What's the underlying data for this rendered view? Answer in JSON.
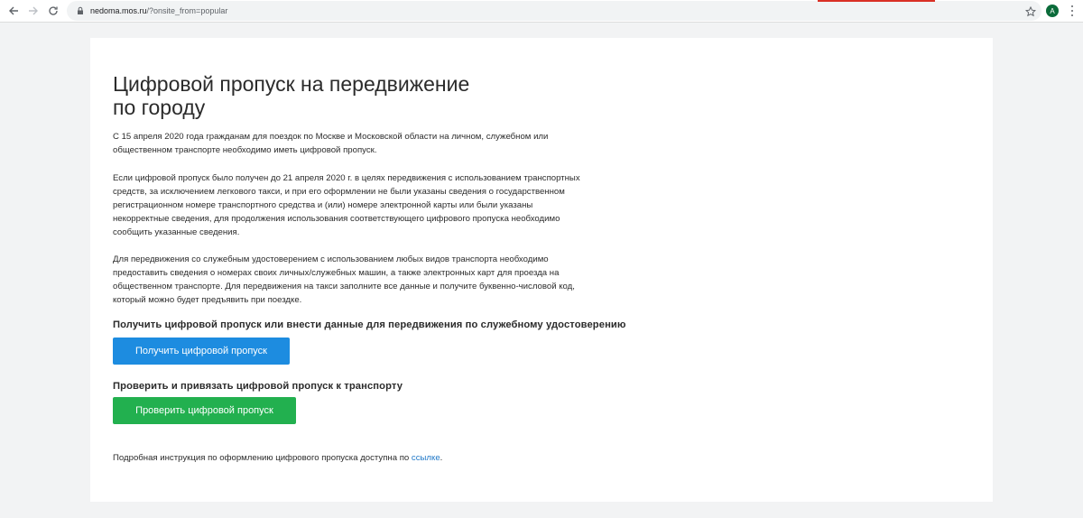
{
  "browser": {
    "url_host": "nedoma.mos.ru",
    "url_path": "/?onsite_from=popular",
    "avatar_letter": "A",
    "accent_color": "#d93025"
  },
  "page": {
    "title": "Цифровой пропуск на передвижение по городу",
    "paragraph1": "С 15 апреля 2020 года гражданам для поездок по Москве и Московской области на личном, служебном или общественном транспорте необходимо иметь цифровой пропуск.",
    "paragraph2": "Если цифровой пропуск было получен до 21 апреля 2020 г. в целях передвижения с использованием транспортных средств, за исключением легкового такси, и при его оформлении не были указаны сведения о государственном регистрационном номере транспортного средства и (или) номере электронной карты или были указаны некорректные сведения, для продолжения использования соответствующего цифрового пропуска необходимо сообщить указанные сведения.",
    "paragraph3": "Для передвижения со служебным удостоверением с использованием любых видов транспорта необходимо предоставить сведения о номерах своих личных/служебных машин, а также электронных карт для проезда на общественном транспорте. Для передвижения на такси заполните все данные и получите буквенно-числовой код, который можно будет предъявить при поездке.",
    "section1_heading": "Получить цифровой пропуск или внести данные для передвижения по служебному удостоверению",
    "get_pass_button": "Получить цифровой пропуск",
    "section2_heading": "Проверить и привязать цифровой пропуск к транспорту",
    "check_pass_button": "Проверить цифровой пропуск",
    "footer_text": "Подробная инструкция по оформлению цифрового пропуска доступна по ",
    "footer_link": "ссылке",
    "footer_end": "."
  },
  "colors": {
    "blue_button": "#1d8ce0",
    "green_button": "#22b04f",
    "link": "#1f78c8"
  }
}
